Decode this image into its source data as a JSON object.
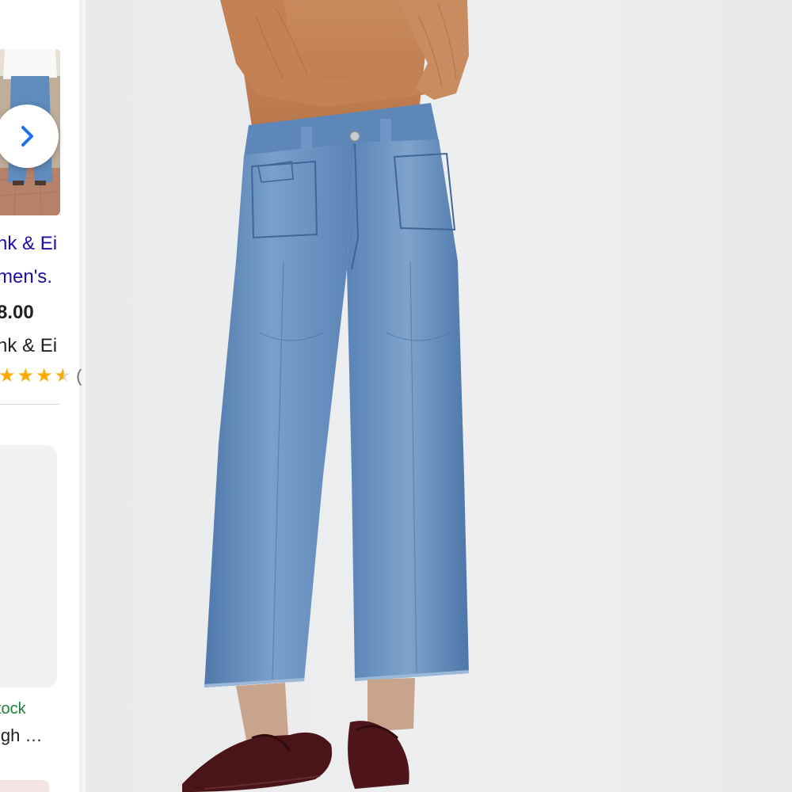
{
  "carousel": {
    "next_icon": "chevron-right-icon",
    "product": {
      "title_line1": "nk & Ei",
      "title_line2": "men's.",
      "price": "8.00",
      "merchant": "nk & Ei",
      "rating": 3.5,
      "rating_max": 5,
      "rating_count": "("
    },
    "second_card": {
      "stock": "tock",
      "description": "igh …"
    }
  },
  "colors": {
    "link": "#1a0dab",
    "star": "#f9ab00",
    "in_stock": "#188038",
    "denim": "#5c86b8",
    "sweater": "#c7865a"
  },
  "main_image": {
    "subject": "wide-leg cropped jeans",
    "icon": "product-photo"
  }
}
